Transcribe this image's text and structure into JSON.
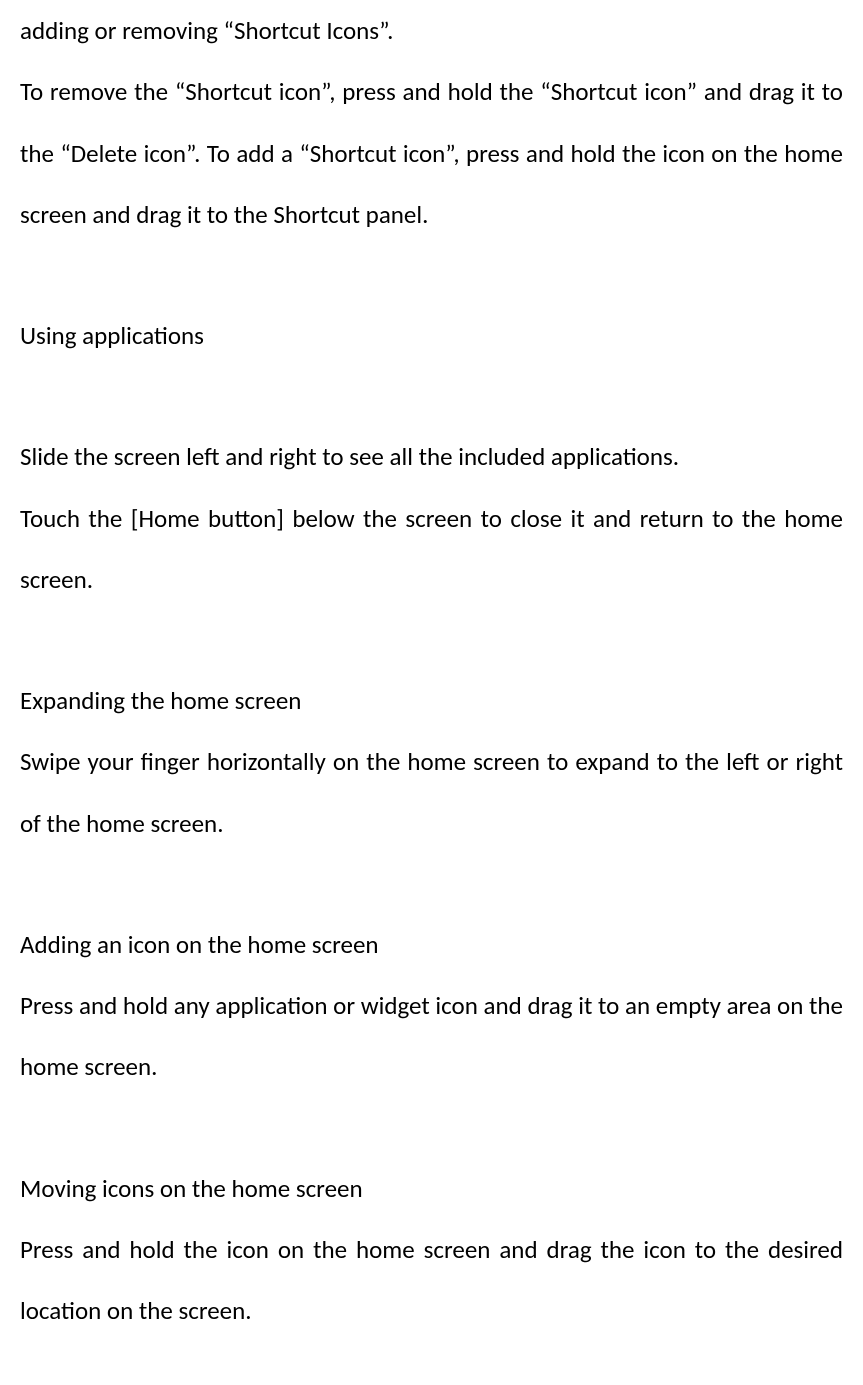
{
  "paragraphs": {
    "p1_line1": "adding or removing “Shortcut Icons”.",
    "p1_body": "To remove the “Shortcut icon”, press and hold the “Shortcut icon” and drag it to the “Delete icon”. To add a “Shortcut icon”, press and hold the icon on the home screen and drag it to the Shortcut panel.",
    "h2": "Using applications",
    "p2_line1": "Slide the screen left and right to see all the included applications.",
    "p2_body": "Touch the [Home button] below the screen to close it and return to the home screen.",
    "h3": "Expanding the home screen",
    "p3_body": "Swipe your finger horizontally on the home screen to expand to the left or right of the home screen.",
    "h4": "Adding an icon on the home screen",
    "p4_body": "Press and hold any application or widget icon and drag it to an empty area on the home screen.",
    "h5": "Moving icons on the home screen",
    "p5_body": "Press and hold the icon on the home screen and drag the icon to the desired location on the screen."
  }
}
